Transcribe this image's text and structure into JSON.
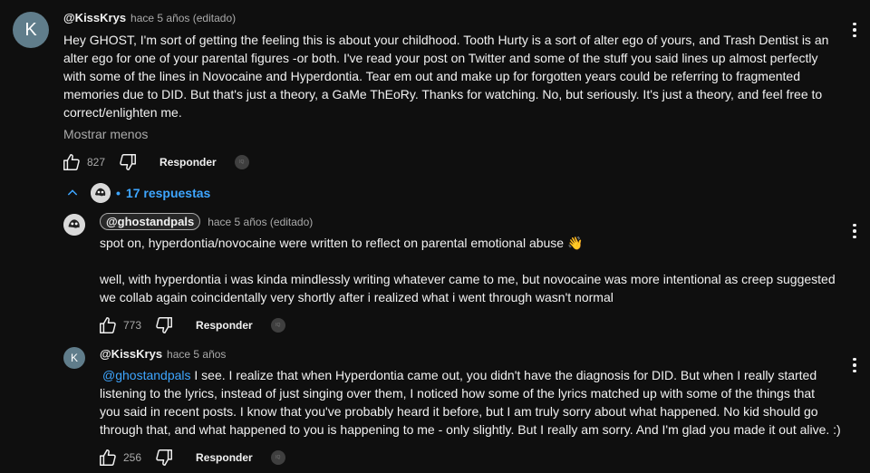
{
  "comments": [
    {
      "avatar_letter": "K",
      "handle": "@KissKrys",
      "meta": "hace 5 años (editado)",
      "lines": [
        "Hey GHOST, I'm sort of getting the feeling this is about your childhood. Tooth Hurty is a sort of alter ego of yours, and Trash Dentist is an",
        "alter ego for one of your parental figures -or both. I've read your post on Twitter and some of the stuff you said lines up almost perfectly",
        "with some of the lines in Novocaine and Hyperdontia. Tear em out and make up for forgotten years could be referring to fragmented",
        "memories due to DID. But that's just a theory, a GaMe ThEoRy. Thanks for watching. No, but seriously. It's just a theory, and feel free to",
        "correct/enlighten me."
      ],
      "show_less": "Mostrar menos",
      "likes": "827",
      "reply_label": "Responder"
    }
  ],
  "replies_toggle": {
    "dot": "•",
    "label": "17 respuestas"
  },
  "replies": [
    {
      "handle": "@ghostandpals",
      "meta": "hace 5 años (editado)",
      "lines": [
        "spot on, hyperdontia/novocaine were written to reflect on parental emotional abuse 👋",
        "",
        "well, with hyperdontia i was kinda mindlessly writing whatever came to me, but novocaine was more intentional as creep suggested",
        "we collab again coincidentally very shortly after i realized what i went through wasn't normal"
      ],
      "likes": "773",
      "reply_label": "Responder"
    },
    {
      "avatar_letter": "K",
      "handle": "@KissKrys",
      "meta": "hace 5 años",
      "mention": "@ghostandpals",
      "first_line_rest": " I see. I realize that when Hyperdontia came out, you didn't have the diagnosis for DID. But when I really started",
      "lines": [
        "listening to the lyrics, instead of just singing over them, I noticed how some of the lyrics matched up with some of the things that",
        "you said in recent posts. I know that you've probably heard it before, but I am truly sorry about what happened. No kid should go",
        "through that, and what happened to you is happening to me - only slightly. But I really am sorry. And I'm glad you made it out alive. :)"
      ],
      "likes": "256",
      "reply_label": "Responder"
    }
  ],
  "icons": {
    "like": "thumbs-up-icon",
    "dislike": "thumbs-down-icon",
    "more": "more-vert-icon",
    "chevron": "chevron-up-icon"
  },
  "colors": {
    "background": "#0f0f0f",
    "text": "#f1f1f1",
    "secondary": "#aaaaaa",
    "link": "#3ea6ff",
    "avatar_k": "#607d8b"
  }
}
